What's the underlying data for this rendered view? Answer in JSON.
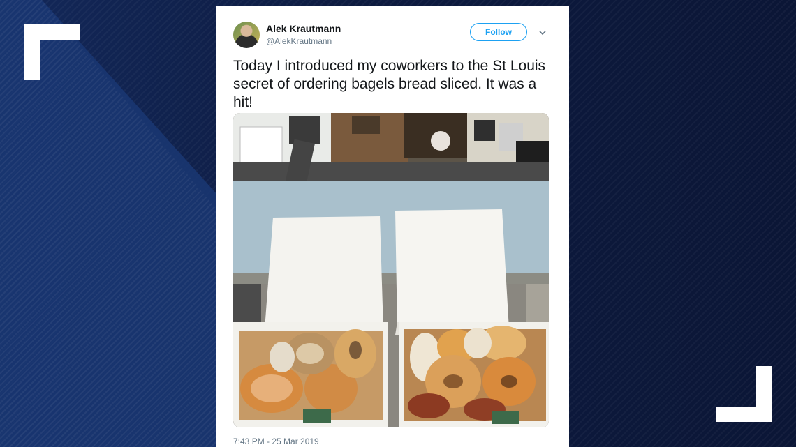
{
  "tweet": {
    "author_name": "Alek Krautmann",
    "author_handle": "@AlekKrautmann",
    "follow_label": "Follow",
    "text": "Today I introduced my coworkers to the St Louis secret of ordering bagels bread sliced. It was a hit!",
    "timestamp": "7:43 PM - 25 Mar 2019",
    "photo_alt": "Two boxes of sliced bagels on an office desk"
  },
  "icons": {
    "menu": "chevron-down-icon",
    "corners": "corner-bracket-icon"
  },
  "colors": {
    "accent": "#1da1f2",
    "background": "#0e1a3a"
  }
}
